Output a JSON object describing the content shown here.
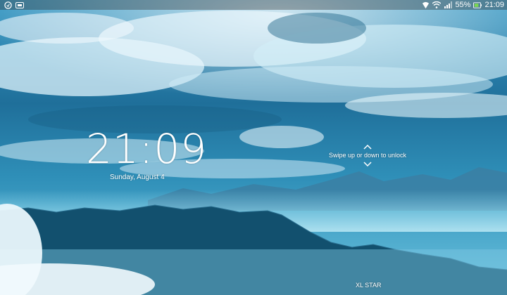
{
  "status_bar": {
    "left_icons": [
      "android-debug-icon",
      "battery-saver-icon"
    ],
    "right_icons": [
      "nfc-icon",
      "wifi-icon",
      "signal-icon",
      "battery-icon"
    ],
    "battery_percent": "55%",
    "time": "21:09"
  },
  "lockscreen": {
    "clock": "21:09",
    "date": "Sunday, August 4",
    "unlock_hint": "Swipe up or down to unlock",
    "carrier": "XL STAR"
  },
  "colors": {
    "sky": "#2b8ab8",
    "text": "#ffffff"
  }
}
